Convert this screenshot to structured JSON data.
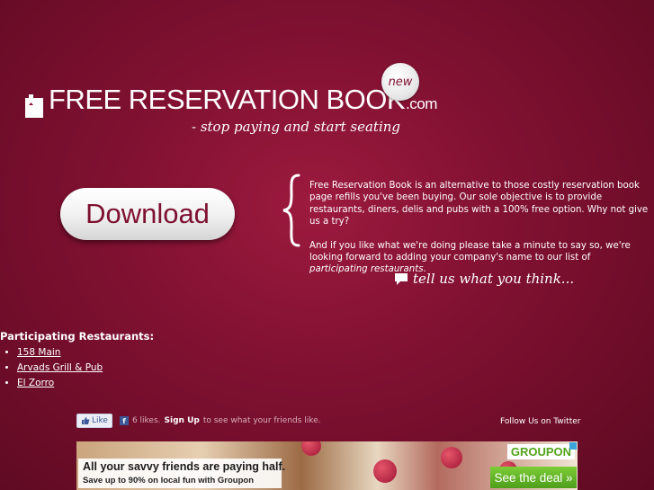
{
  "header": {
    "logo_text": "FREE RESERVATION BOOK",
    "logo_suffix": ".com",
    "badge": "new",
    "tagline": "- stop paying and start seating"
  },
  "download_label": "Download",
  "about": {
    "para1": "Free Reservation Book is an alternative to those costly reservation book page refills you've been buying. Our sole objective is to provide restaurants, diners, delis and pubs with a 100% free option. Why not give us a try?",
    "para2_lead": "And if you like what we're doing please take a minute to say so, we're looking forward to adding your company's name to our list of ",
    "para2_em": "participating restaurants",
    "para2_end": "."
  },
  "feedback_label": "tell us what you think...",
  "participating": {
    "title": "Participating Restaurants:",
    "items": [
      {
        "label": "158 Main"
      },
      {
        "label": "Arvads Grill & Pub"
      },
      {
        "label": "El Zorro"
      }
    ]
  },
  "social": {
    "like_label": "Like",
    "fb_icon": "f",
    "likes_text": "6 likes.",
    "signup_label": "Sign Up",
    "signup_tail": "to see what your friends like.",
    "twitter_label": "Follow Us on Twitter"
  },
  "ad": {
    "headline": "All your savvy friends are paying half.",
    "subline": "Save up to 90% on local fun with Groupon",
    "brand": "GROUPON",
    "cta": "See the deal »"
  },
  "colors": {
    "background": "#7e1030",
    "accent_green": "#53a318",
    "facebook_blue": "#3b5998"
  }
}
